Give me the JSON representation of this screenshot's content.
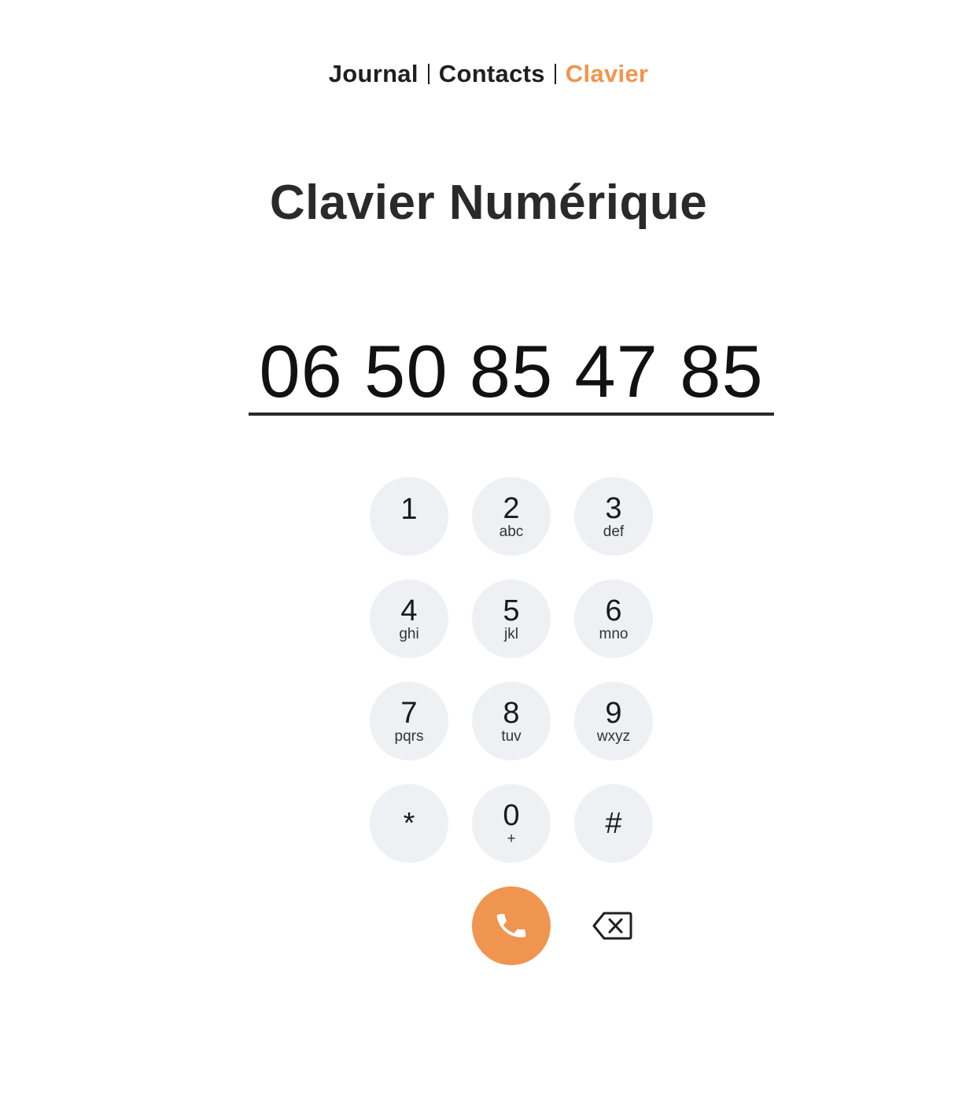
{
  "nav": {
    "items": [
      {
        "label": "Journal",
        "active": false
      },
      {
        "label": "Contacts",
        "active": false
      },
      {
        "label": "Clavier",
        "active": true
      }
    ]
  },
  "title": "Clavier Numérique",
  "dial": {
    "value": "06 50 85 47 85"
  },
  "keypad": {
    "keys": [
      {
        "digit": "1",
        "letters": ""
      },
      {
        "digit": "2",
        "letters": "abc"
      },
      {
        "digit": "3",
        "letters": "def"
      },
      {
        "digit": "4",
        "letters": "ghi"
      },
      {
        "digit": "5",
        "letters": "jkl"
      },
      {
        "digit": "6",
        "letters": "mno"
      },
      {
        "digit": "7",
        "letters": "pqrs"
      },
      {
        "digit": "8",
        "letters": "tuv"
      },
      {
        "digit": "9",
        "letters": "wxyz"
      },
      {
        "digit": "*",
        "letters": ""
      },
      {
        "digit": "0",
        "letters": "+"
      },
      {
        "digit": "#",
        "letters": ""
      }
    ]
  },
  "actions": {
    "call_icon": "phone-icon",
    "backspace_icon": "backspace-icon"
  },
  "colors": {
    "accent": "#f0954f",
    "key_background": "#eff0f3",
    "text": "#1f1f1f"
  }
}
